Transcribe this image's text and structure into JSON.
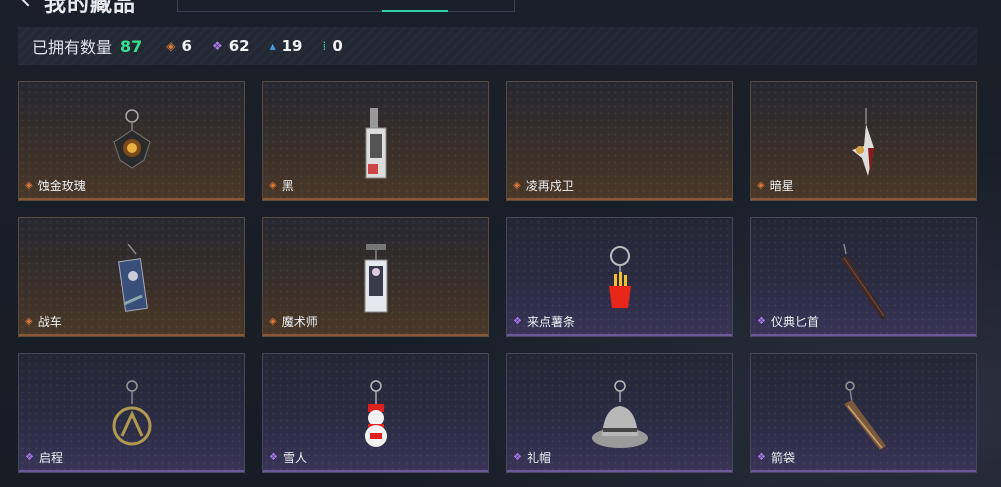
{
  "header": {
    "title": "我的藏品"
  },
  "stats": {
    "owned_label": "已拥有数量",
    "owned_count": "87",
    "rarities": [
      {
        "icon": "orange-diamond-icon",
        "value": "6",
        "color": "#e07a3a"
      },
      {
        "icon": "purple-diamond-icon",
        "value": "62",
        "color": "#a77de6"
      },
      {
        "icon": "blue-triangle-icon",
        "value": "19",
        "color": "#4a9ee6"
      },
      {
        "icon": "teal-dots-icon",
        "value": "0",
        "color": "#35c9a6"
      }
    ]
  },
  "items": [
    {
      "name": "蚀金玫瑰",
      "rarity": "orange"
    },
    {
      "name": "黑",
      "rarity": "orange"
    },
    {
      "name": "凌再戍卫",
      "rarity": "orange"
    },
    {
      "name": "暗星",
      "rarity": "orange"
    },
    {
      "name": "战车",
      "rarity": "orange"
    },
    {
      "name": "魔术师",
      "rarity": "orange"
    },
    {
      "name": "来点薯条",
      "rarity": "purple"
    },
    {
      "name": "仪典匕首",
      "rarity": "purple"
    },
    {
      "name": "启程",
      "rarity": "purple"
    },
    {
      "name": "雪人",
      "rarity": "purple"
    },
    {
      "name": "礼帽",
      "rarity": "purple"
    },
    {
      "name": "箭袋",
      "rarity": "purple"
    }
  ]
}
